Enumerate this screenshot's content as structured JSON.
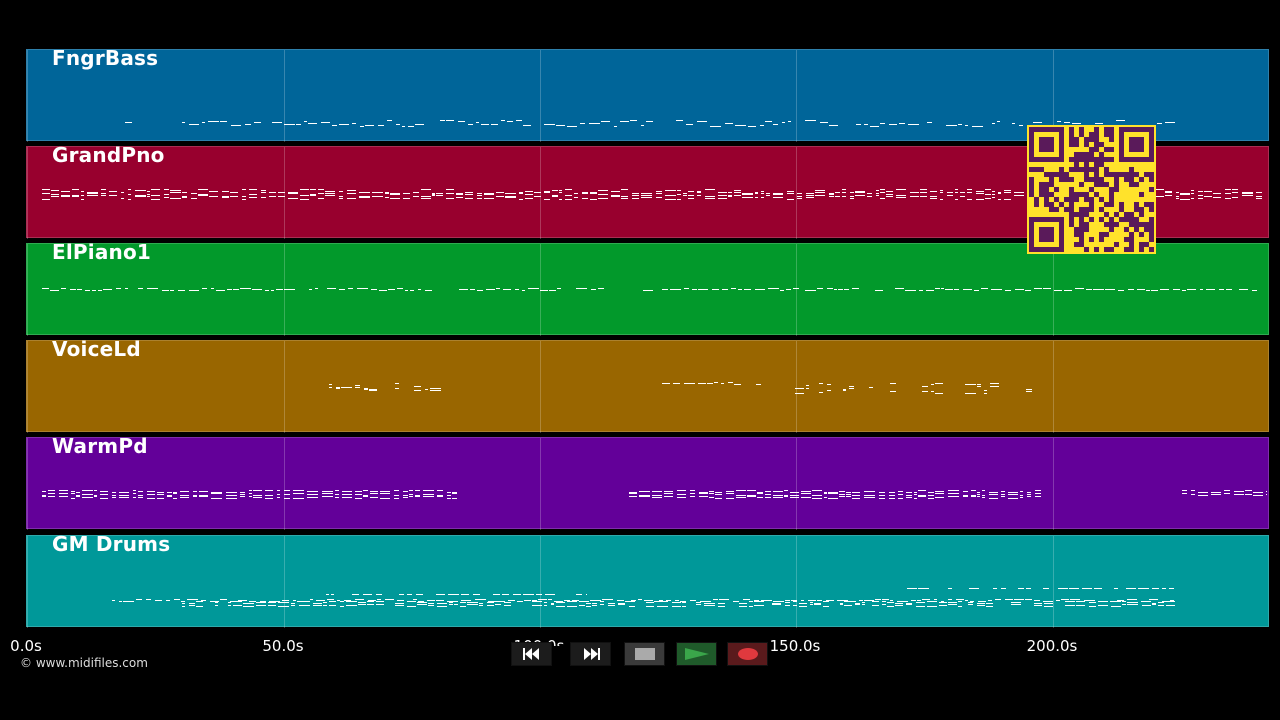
{
  "tracks": [
    {
      "name": "FngrBass",
      "color": "#006599"
    },
    {
      "name": "GrandPno",
      "color": "#98002e"
    },
    {
      "name": "ElPiano1",
      "color": "#02992b"
    },
    {
      "name": "VoiceLd",
      "color": "#996600"
    },
    {
      "name": "WarmPd",
      "color": "#630099"
    },
    {
      "name": "GM Drums",
      "color": "#009899"
    }
  ],
  "timeline": {
    "ticks": [
      "0.0s",
      "50.0s",
      "100.0s",
      "150.0s",
      "200.0s"
    ],
    "tick_values": [
      0,
      50,
      100,
      150,
      200
    ]
  },
  "footer": {
    "copyright": "© www.midifiles.com"
  },
  "transport": {
    "rewind_icon": "rewind-icon",
    "fast_forward_icon": "fast-forward-icon",
    "stop_icon": "stop-icon",
    "play_icon": "play-icon",
    "record_icon": "record-icon",
    "play_color": "#3aa64a",
    "record_color": "#e0393e"
  }
}
